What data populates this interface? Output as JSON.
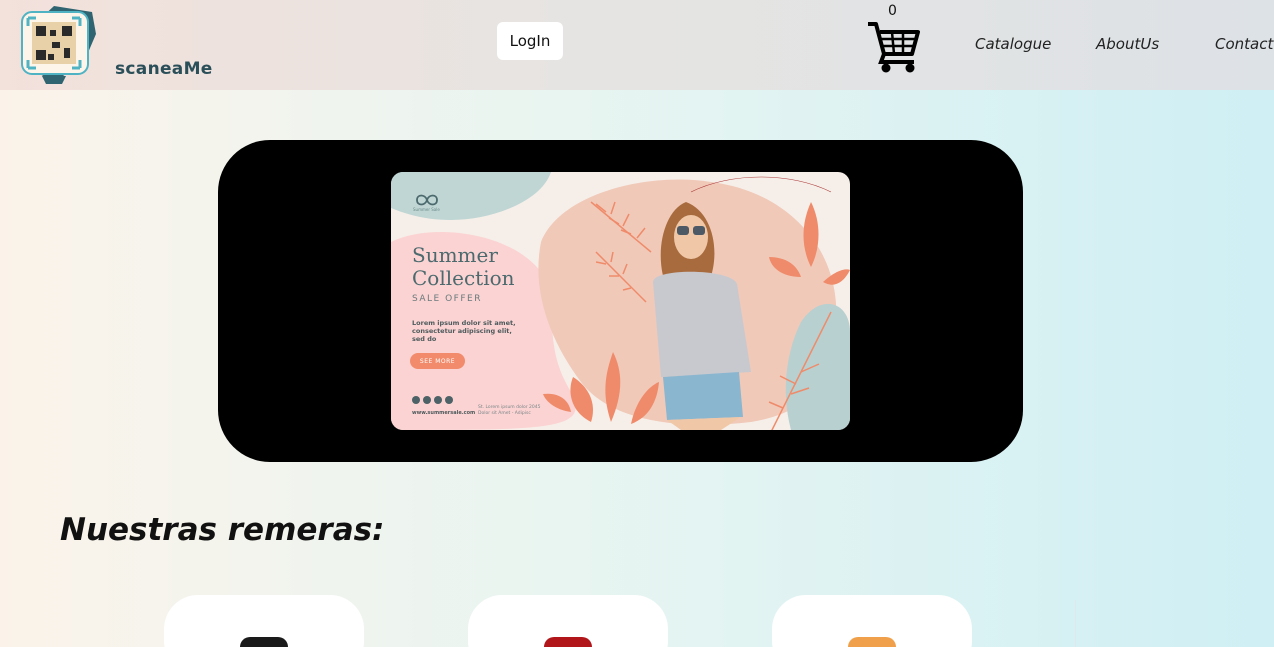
{
  "header": {
    "brand": "scaneaMe",
    "login_label": "LogIn",
    "cart_count": "0",
    "nav": [
      "Catalogue",
      "AboutUs",
      "Contact"
    ]
  },
  "banner": {
    "title_line1": "Summer",
    "title_line2": "Collection",
    "subtitle": "SALE OFFER",
    "body": "Lorem ipsum dolor sit amet, consectetur adipiscing elit, sed do",
    "button": "SEE MORE",
    "website": "www.summersale.com",
    "address": "St. Lorem ipsum dolor 2045 Dolor sit Amet - Adipisc",
    "brand": "Summer Sale"
  },
  "section": {
    "title": "Nuestras remeras:"
  },
  "products": [
    {
      "shirt_color": "#1a1a1a"
    },
    {
      "shirt_color": "#b0161a"
    },
    {
      "shirt_color": "#f0a04a"
    }
  ],
  "colors": {
    "accent_coral": "#f28b6c",
    "teal_text": "#4c6a6e",
    "hero_bg": "#000000"
  }
}
